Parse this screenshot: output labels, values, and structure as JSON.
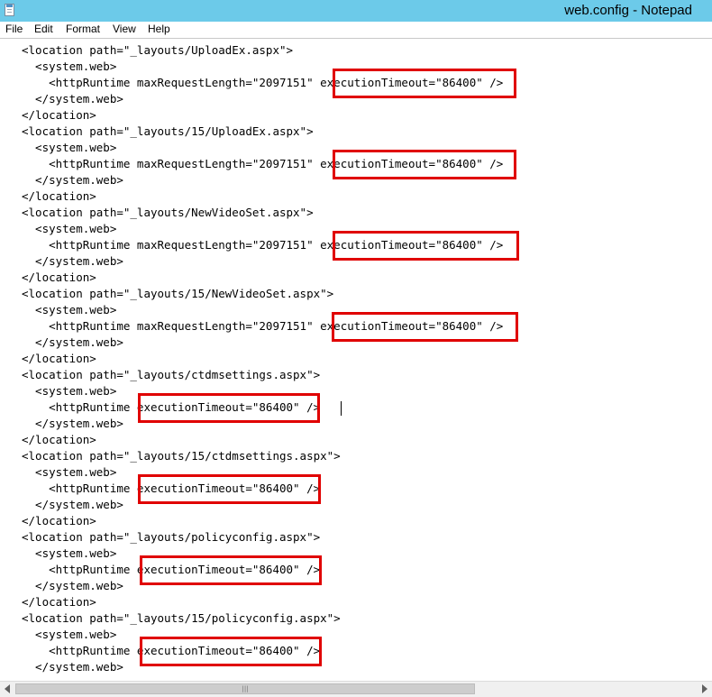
{
  "window": {
    "title": "web.config - Notepad",
    "icon": "notepad-icon"
  },
  "menu": [
    {
      "label": "File"
    },
    {
      "label": "Edit"
    },
    {
      "label": "Format"
    },
    {
      "label": "View"
    },
    {
      "label": "Help"
    }
  ],
  "editor": {
    "lines": [
      "<location path=\"_layouts/UploadEx.aspx\">",
      "  <system.web>",
      "    <httpRuntime maxRequestLength=\"2097151\" executionTimeout=\"86400\" />",
      "  </system.web>",
      "</location>",
      "<location path=\"_layouts/15/UploadEx.aspx\">",
      "  <system.web>",
      "    <httpRuntime maxRequestLength=\"2097151\" executionTimeout=\"86400\" />",
      "  </system.web>",
      "</location>",
      "<location path=\"_layouts/NewVideoSet.aspx\">",
      "  <system.web>",
      "    <httpRuntime maxRequestLength=\"2097151\" executionTimeout=\"86400\" />",
      "  </system.web>",
      "</location>",
      "<location path=\"_layouts/15/NewVideoSet.aspx\">",
      "  <system.web>",
      "    <httpRuntime maxRequestLength=\"2097151\" executionTimeout=\"86400\" />",
      "  </system.web>",
      "</location>",
      "<location path=\"_layouts/ctdmsettings.aspx\">",
      "  <system.web>",
      "    <httpRuntime executionTimeout=\"86400\" />",
      "  </system.web>",
      "</location>",
      "<location path=\"_layouts/15/ctdmsettings.aspx\">",
      "  <system.web>",
      "    <httpRuntime executionTimeout=\"86400\" />",
      "  </system.web>",
      "</location>",
      "<location path=\"_layouts/policyconfig.aspx\">",
      "  <system.web>",
      "    <httpRuntime executionTimeout=\"86400\" />",
      "  </system.web>",
      "</location>",
      "<location path=\"_layouts/15/policyconfig.aspx\">",
      "  <system.web>",
      "    <httpRuntime executionTimeout=\"86400\" />",
      "  </system.web>"
    ],
    "highlight_color": "#e00000"
  },
  "scrollbar": {
    "grip_icon": "scroll-grip-icon"
  }
}
